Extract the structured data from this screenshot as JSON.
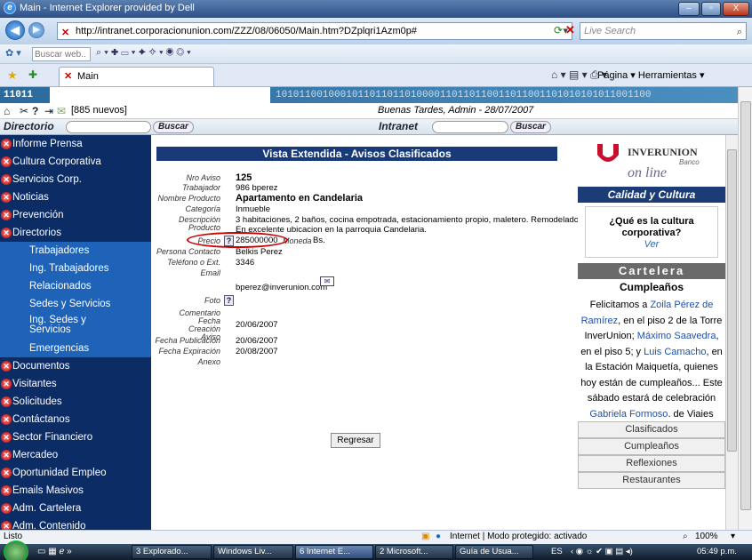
{
  "window": {
    "title": "Main - Internet Explorer provided by Dell",
    "minimize": "–",
    "maximize": "▫",
    "close": "X"
  },
  "browser": {
    "url": "http://intranet.corporacionunion.com/ZZZ/08/06050/Main.htm?DZplqri1Azm0p#",
    "search_placeholder": "Live Search",
    "links_search": "Buscar web..",
    "tab_label": "Main",
    "tools": "Página ▾   Herramientas ▾"
  },
  "site": {
    "binary_strip": "11011                                             1010110010001011011011010000110110110011011001101010101011001100",
    "binary_num": "11011",
    "mail_count": "[885 nuevos]",
    "greeting": "Buenas Tardes, Admin - 28/07/2007",
    "directorio_label": "Directorio",
    "intranet_label": "Intranet",
    "buscar_1": "Buscar",
    "buscar_2": "Buscar"
  },
  "nav": {
    "items": [
      {
        "label": "Informe Prensa"
      },
      {
        "label": "Cultura Corporativa"
      },
      {
        "label": "Servicios Corp."
      },
      {
        "label": "Noticias"
      },
      {
        "label": "Prevención"
      },
      {
        "label": "Directorios"
      },
      {
        "label": "Trabajadores"
      },
      {
        "label": "Ing. Trabajadores"
      },
      {
        "label": "Relacionados"
      },
      {
        "label": "Sedes y Servicios"
      },
      {
        "label": "Ing. Sedes y Servicios"
      },
      {
        "label": "Emergencias"
      },
      {
        "label": "Documentos"
      },
      {
        "label": "Visitantes"
      },
      {
        "label": "Solicitudes"
      },
      {
        "label": "Contáctanos"
      },
      {
        "label": "Sector Financiero"
      },
      {
        "label": "Mercadeo"
      },
      {
        "label": "Oportunidad Empleo"
      },
      {
        "label": "Emails Masivos"
      },
      {
        "label": "Adm. Cartelera"
      },
      {
        "label": "Adm. Contenido"
      }
    ]
  },
  "detail": {
    "heading": "Vista Extendida - Avisos Clasificados",
    "labels": {
      "nro": "Nro Aviso",
      "trabajador": "Trabajador",
      "nombre": "Nombre Producto",
      "categoria": "Categoría",
      "descripcion": "Descripción Producto",
      "precio": "Precio",
      "moneda": "Moneda",
      "persona": "Persona Contacto",
      "telefono": "Teléfono o Ext.",
      "email": "Email",
      "foto": "Foto",
      "comentario": "Comentario",
      "creacion": "Fecha Creación Aviso",
      "publicacion": "Fecha Publicación",
      "expiracion": "Fecha Expiración",
      "anexo": "Anexo"
    },
    "values": {
      "nro": "125",
      "trabajador": "986 bperez",
      "nombre": "Apartamento en Candelaria",
      "categoria": "Inmueble",
      "descripcion_1": "3 habitaciones, 2 baños, cocina empotrada, estacionamiento propio, maletero. Remodelado.",
      "descripcion_2": "En excelente ubicacion en la parroquia Candelaria.",
      "precio": "285000000",
      "moneda": "Bs.",
      "persona": "Belkis Perez",
      "telefono": "3346",
      "email": "bperez@inverunion.com",
      "creacion": "20/06/2007",
      "publicacion": "20/06/2007",
      "expiracion": "20/08/2007"
    },
    "regresar": "Regresar"
  },
  "right": {
    "brand": "INVERUNION",
    "brand_sub": "Banco",
    "online": "on line",
    "calidad": "Calidad y Cultura",
    "que_es": "¿Qué es la cultura corporativa?",
    "ver": "Ver",
    "cartelera": "Cartelera",
    "cumple_title": "Cumpleaños",
    "cumple_text_1": "Felicitamos a",
    "name_1": "Zoila Pérez de Ramírez",
    "cumple_text_2": ", en el piso 2 de la Torre InverUnion;",
    "name_2": "Máximo Saavedra",
    "cumple_text_3": ", en el piso 5; y",
    "name_3": "Luis Camacho",
    "cumple_text_4": ", en la Estación Maiquetía, quienes hoy están de cumpleaños... Este sábado estará de celebración",
    "name_4": "Gabriela Formoso",
    "cumple_text_5": ", de Viajes Union",
    "menu": [
      "Clasificados",
      "Cumpleaños",
      "Reflexiones",
      "Restaurantes"
    ]
  },
  "status": {
    "left": "Listo",
    "zone": "Internet | Modo protegido: activado",
    "zoom": "100%"
  },
  "taskbar": {
    "items": [
      "3 Explorado...",
      "Windows Liv...",
      "6 Internet E...",
      "2 Microsoft...",
      "Guía de Usua..."
    ],
    "lang": "ES",
    "clock": "05:49 p.m."
  },
  "colors": {
    "nav_bg": "#0c2c66",
    "nav_sub_bg": "#1f63b8",
    "heading_bg": "#183a78",
    "price_highlight": "#cc0000"
  }
}
